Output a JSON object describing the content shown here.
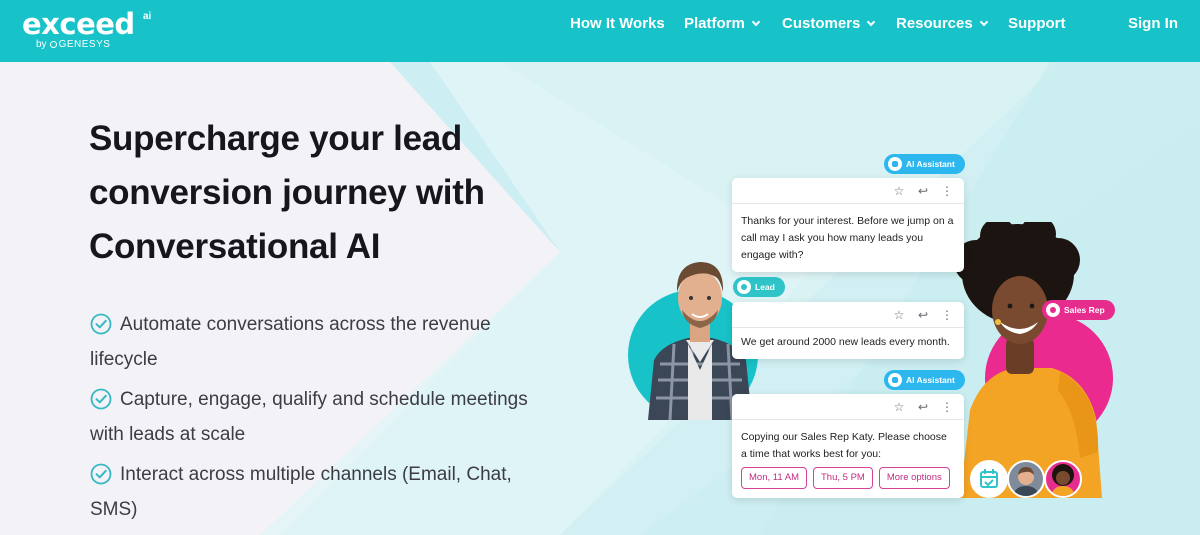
{
  "brand": {
    "logo_text": "exceed",
    "logo_suffix": "ai",
    "byline": "by",
    "parent": "GENESYS"
  },
  "nav": {
    "items": [
      {
        "label": "How It Works",
        "dropdown": false
      },
      {
        "label": "Platform",
        "dropdown": true
      },
      {
        "label": "Customers",
        "dropdown": true
      },
      {
        "label": "Resources",
        "dropdown": true
      },
      {
        "label": "Support",
        "dropdown": false
      }
    ],
    "sign_in": "Sign In"
  },
  "hero": {
    "headline": "Supercharge your lead conversion journey with Conversational AI",
    "bullets": [
      "Automate conversations across the revenue lifecycle",
      "Capture, engage, qualify and schedule meetings with leads at scale",
      "Interact across multiple channels (Email, Chat, SMS)"
    ]
  },
  "chat": {
    "tags": {
      "ai_assistant": "AI Assistant",
      "lead": "Lead",
      "sales_rep": "Sales Rep"
    },
    "messages": [
      "Thanks for your interest. Before we jump on a call may I ask you how many leads you engage with?",
      "We get around 2000 new leads every month.",
      "Copying our Sales Rep Katy. Please choose a time that works best for you:"
    ],
    "slots": [
      "Mon, 11 AM",
      "Thu, 5 PM",
      "More options"
    ],
    "card_icons": [
      "star-icon",
      "reply-icon",
      "more-vertical-icon"
    ]
  },
  "colors": {
    "nav_bg": "#17c3c8",
    "teal": "#17c3c8",
    "pink": "#ea2a8f",
    "ai_tag": "#2cb7ee",
    "check": "#35b8c4"
  }
}
